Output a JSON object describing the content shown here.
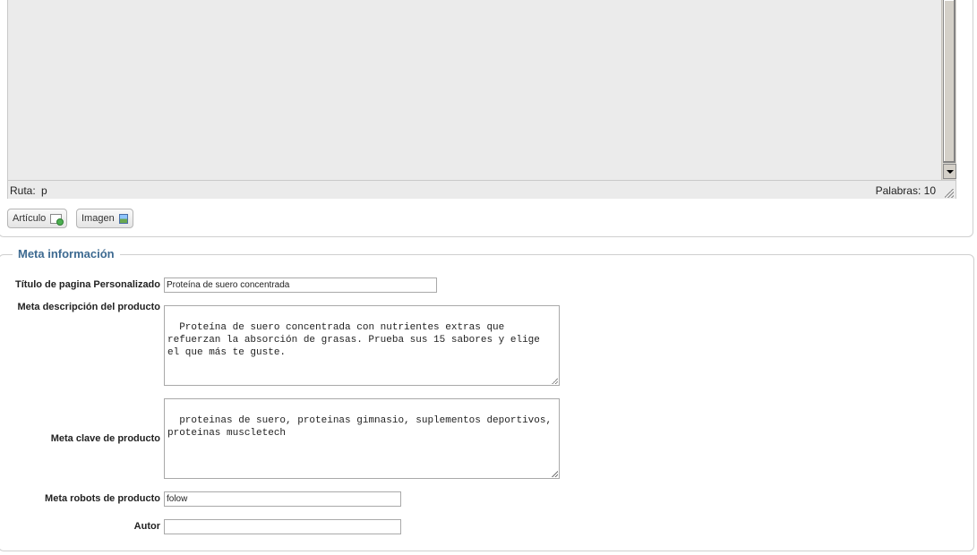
{
  "editor": {
    "status_path_label": "Ruta:",
    "status_path_value": "p",
    "status_words": "Palabras: 10",
    "buttons": {
      "articulo": "Artículo",
      "imagen": "Imagen"
    }
  },
  "meta": {
    "legend": "Meta información",
    "page_title": {
      "label": "Título de pagina Personalizado",
      "value": "Proteína de suero concentrada"
    },
    "description": {
      "label": "Meta descripción del producto",
      "value": "Proteína de suero concentrada con nutrientes extras que refuerzan la absorción de grasas. Prueba sus 15 sabores y elige el que más te guste."
    },
    "keywords": {
      "label": "Meta clave de producto",
      "value": "proteinas de suero, proteinas gimnasio, suplementos deportivos, proteinas muscletech"
    },
    "robots": {
      "label": "Meta robots de producto",
      "value": "folow"
    },
    "author": {
      "label": "Autor",
      "value": ""
    }
  }
}
